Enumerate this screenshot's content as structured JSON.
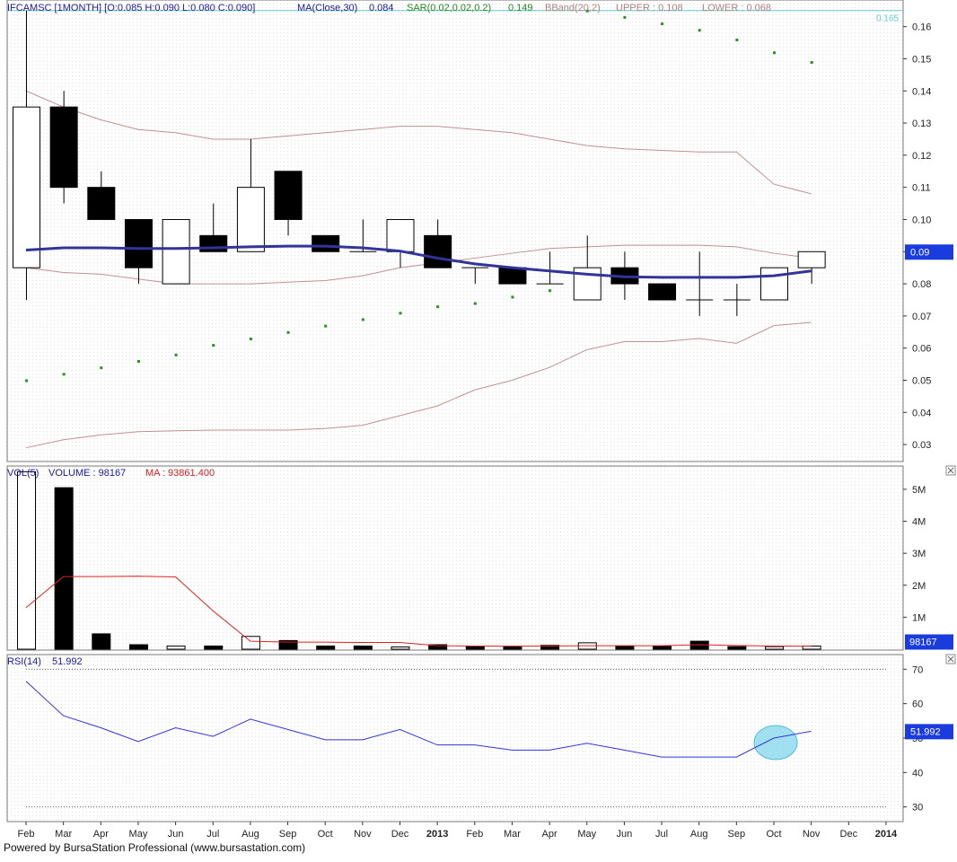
{
  "footer": "Powered by BursaStation Professional (www.bursastation.com)",
  "colors": {
    "up_body": "#ffffff",
    "down_body": "#000000",
    "ma_line": "#333399",
    "bband": "#c09090",
    "sar": "#2e8b2e",
    "vol_ma": "#dd2222",
    "rsi": "#3333dd",
    "price_badge": "#1a3bdd",
    "highlight": "#88d8ee",
    "last_price_line": "#66cccc"
  },
  "icons": {
    "panel_close": "close-box-icon"
  },
  "price_panel": {
    "header": {
      "symbol": "IFCAMSC [1MONTH] [O:0.085 H:0.090 L:0.080 C:0.090]",
      "ma_label": "MA(Close,30)",
      "ma_value": "0.084",
      "sar_label": "SAR(0.02,0.02,0.2)",
      "sar_value": "0.149",
      "bband_label": "BBand(20,2)",
      "upper_label": "UPPER : 0.108",
      "lower_label": "LOWER : 0.068"
    },
    "last_line_label": "0.165",
    "badge": "0.09"
  },
  "volume_panel": {
    "header": {
      "label": "VOL(5)",
      "volume": "VOLUME : 98167",
      "ma": "MA : 93861.400"
    },
    "badge": "98167"
  },
  "rsi_panel": {
    "header": {
      "label": "RSI(14)",
      "value": "51.992"
    },
    "badge": "51.992"
  },
  "chart_data": [
    {
      "type": "candlestick",
      "x": [
        "Feb",
        "Mar",
        "Apr",
        "May",
        "Jun",
        "Jul",
        "Aug",
        "Sep",
        "Oct",
        "Nov",
        "Dec",
        "2013",
        "Feb",
        "Mar",
        "Apr",
        "May",
        "Jun",
        "Jul",
        "Aug",
        "Sep",
        "Oct",
        "Nov",
        "Dec",
        "2014"
      ],
      "ylim": [
        0.025,
        0.168
      ],
      "yticks": [
        "0.03",
        "0.04",
        "0.05",
        "0.06",
        "0.07",
        "0.08",
        "0.09",
        "0.10",
        "0.11",
        "0.12",
        "0.13",
        "0.14",
        "0.15",
        "0.16"
      ],
      "candles": [
        {
          "o": 0.085,
          "h": 0.165,
          "l": 0.075,
          "c": 0.135
        },
        {
          "o": 0.135,
          "h": 0.14,
          "l": 0.105,
          "c": 0.11
        },
        {
          "o": 0.11,
          "h": 0.115,
          "l": 0.1,
          "c": 0.1
        },
        {
          "o": 0.1,
          "h": 0.1,
          "l": 0.08,
          "c": 0.085
        },
        {
          "o": 0.08,
          "h": 0.1,
          "l": 0.08,
          "c": 0.1
        },
        {
          "o": 0.095,
          "h": 0.105,
          "l": 0.09,
          "c": 0.09
        },
        {
          "o": 0.09,
          "h": 0.125,
          "l": 0.09,
          "c": 0.11
        },
        {
          "o": 0.115,
          "h": 0.115,
          "l": 0.095,
          "c": 0.1
        },
        {
          "o": 0.095,
          "h": 0.095,
          "l": 0.09,
          "c": 0.09
        },
        {
          "o": 0.09,
          "h": 0.1,
          "l": 0.09,
          "c": 0.09
        },
        {
          "o": 0.09,
          "h": 0.1,
          "l": 0.085,
          "c": 0.1
        },
        {
          "o": 0.095,
          "h": 0.1,
          "l": 0.085,
          "c": 0.085
        },
        {
          "o": 0.085,
          "h": 0.085,
          "l": 0.08,
          "c": 0.085
        },
        {
          "o": 0.085,
          "h": 0.085,
          "l": 0.08,
          "c": 0.08
        },
        {
          "o": 0.08,
          "h": 0.09,
          "l": 0.08,
          "c": 0.08
        },
        {
          "o": 0.075,
          "h": 0.095,
          "l": 0.075,
          "c": 0.085
        },
        {
          "o": 0.085,
          "h": 0.09,
          "l": 0.075,
          "c": 0.08
        },
        {
          "o": 0.08,
          "h": 0.08,
          "l": 0.075,
          "c": 0.075
        },
        {
          "o": 0.075,
          "h": 0.09,
          "l": 0.07,
          "c": 0.075
        },
        {
          "o": 0.075,
          "h": 0.08,
          "l": 0.07,
          "c": 0.075
        },
        {
          "o": 0.075,
          "h": 0.085,
          "l": 0.075,
          "c": 0.085
        },
        {
          "o": 0.085,
          "h": 0.09,
          "l": 0.08,
          "c": 0.09
        }
      ],
      "ma30": [
        0.0905,
        0.0912,
        0.0912,
        0.091,
        0.091,
        0.0912,
        0.0915,
        0.0917,
        0.0917,
        0.0912,
        0.0902,
        0.088,
        0.0862,
        0.085,
        0.084,
        0.083,
        0.0822,
        0.082,
        0.082,
        0.082,
        0.0825,
        0.084
      ],
      "bband_upper": [
        0.14,
        0.135,
        0.131,
        0.128,
        0.127,
        0.125,
        0.125,
        0.126,
        0.127,
        0.128,
        0.129,
        0.129,
        0.128,
        0.127,
        0.125,
        0.123,
        0.122,
        0.1215,
        0.121,
        0.121,
        0.111,
        0.108
      ],
      "bband_mid": [
        0.085,
        0.0835,
        0.083,
        0.0815,
        0.08,
        0.08,
        0.08,
        0.0805,
        0.081,
        0.0825,
        0.085,
        0.0865,
        0.088,
        0.0895,
        0.091,
        0.0915,
        0.092,
        0.092,
        0.092,
        0.0915,
        0.0895,
        0.088
      ],
      "bband_lower": [
        0.029,
        0.0315,
        0.033,
        0.034,
        0.0343,
        0.0345,
        0.0345,
        0.0345,
        0.035,
        0.036,
        0.039,
        0.042,
        0.047,
        0.05,
        0.054,
        0.0595,
        0.062,
        0.062,
        0.063,
        0.0615,
        0.067,
        0.068
      ],
      "sar": [
        0.05,
        0.052,
        0.054,
        0.056,
        0.058,
        0.061,
        0.063,
        0.065,
        0.067,
        0.069,
        0.071,
        0.073,
        0.074,
        0.076,
        0.078,
        0.165,
        0.163,
        0.161,
        0.159,
        0.156,
        0.152,
        0.149
      ],
      "last_price_line": 0.165
    },
    {
      "type": "bar",
      "x": [
        "Feb",
        "Mar",
        "Apr",
        "May",
        "Jun",
        "Jul",
        "Aug",
        "Sep",
        "Oct",
        "Nov",
        "Dec",
        "2013",
        "Feb",
        "Mar",
        "Apr",
        "May",
        "Jun",
        "Jul",
        "Aug",
        "Sep",
        "Oct",
        "Nov"
      ],
      "ylim": [
        0,
        5700000
      ],
      "yticks": [
        "1M",
        "2M",
        "3M",
        "4M",
        "5M"
      ],
      "volume": [
        5550000,
        5050000,
        480000,
        140000,
        100000,
        100000,
        400000,
        270000,
        100000,
        100000,
        70000,
        140000,
        80000,
        80000,
        120000,
        200000,
        100000,
        90000,
        250000,
        80000,
        80000,
        98167
      ],
      "up": [
        true,
        false,
        false,
        false,
        true,
        false,
        true,
        false,
        false,
        false,
        true,
        false,
        false,
        false,
        false,
        true,
        false,
        false,
        false,
        false,
        true,
        true
      ],
      "ma5": [
        1300000,
        2270000,
        2270000,
        2280000,
        2260000,
        1200000,
        250000,
        220000,
        220000,
        210000,
        210000,
        110000,
        100000,
        95000,
        100000,
        110000,
        110000,
        110000,
        140000,
        115000,
        100000,
        93861.4
      ]
    },
    {
      "type": "line",
      "x": [
        "Feb",
        "Mar",
        "Apr",
        "May",
        "Jun",
        "Jul",
        "Aug",
        "Sep",
        "Oct",
        "Nov",
        "Dec",
        "2013",
        "Feb",
        "Mar",
        "Apr",
        "May",
        "Jun",
        "Jul",
        "Aug",
        "Sep",
        "Oct",
        "Nov"
      ],
      "ylim": [
        26,
        74
      ],
      "yticks": [
        "30",
        "40",
        "50",
        "60",
        "70"
      ],
      "reference_lines": [
        30,
        70
      ],
      "rsi14": [
        66.5,
        56.5,
        53,
        49,
        53,
        50.5,
        55.5,
        52.5,
        49.5,
        49.5,
        52.5,
        48,
        48,
        46.5,
        46.5,
        48.5,
        46.5,
        44.5,
        44.5,
        44.5,
        50,
        51.992
      ]
    }
  ]
}
